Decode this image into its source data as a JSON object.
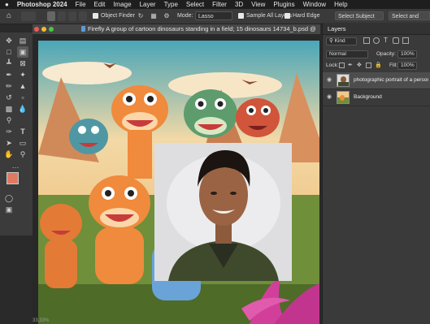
{
  "menubar": {
    "apple": "",
    "items": [
      "Photoshop 2024",
      "File",
      "Edit",
      "Image",
      "Layer",
      "Type",
      "Select",
      "Filter",
      "3D",
      "View",
      "Plugins",
      "Window",
      "Help"
    ]
  },
  "options": {
    "object_finder_label": "Object Finder",
    "mode_label": "Mode:",
    "mode_value": "Lasso",
    "sample_all_layers": "Sample All Layers",
    "hard_edge": "Hard Edge",
    "select_subject": "Select Subject",
    "select_and_mask": "Select and Mask"
  },
  "document": {
    "title": "Firefly A group of cartoon dinosaurs standing in a field; 15 dinosaurs 14734_b.psd @ 33,3% (pho..."
  },
  "status": {
    "zoom": "33,33%"
  },
  "layers_panel": {
    "tab": "Layers",
    "kind_label": "Kind",
    "blend_mode": "Normal",
    "opacity_label": "Opacity:",
    "opacity_value": "100%",
    "lock_label": "Lock:",
    "fill_label": "Fill:",
    "fill_value": "100%",
    "layers": [
      {
        "name": "photographic portrait of a person",
        "visible": true,
        "selected": true
      },
      {
        "name": "Background",
        "visible": true,
        "selected": false
      }
    ]
  },
  "colors": {
    "foreground": "#e07a5f",
    "background": "#ffffff"
  }
}
